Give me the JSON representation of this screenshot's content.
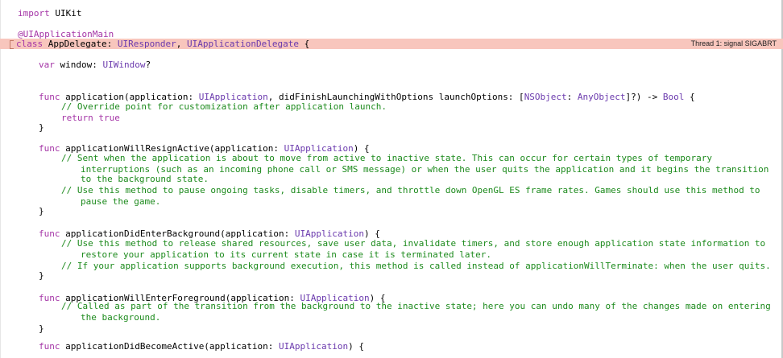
{
  "editor": {
    "lines": [
      [
        {
          "t": "import ",
          "c": "kw"
        },
        {
          "t": "UIKit",
          "c": "tx"
        }
      ],
      [],
      [
        {
          "t": "@UIApplicationMain",
          "c": "kw"
        }
      ],
      [
        {
          "t": "class ",
          "c": "kw"
        },
        {
          "t": "AppDelegate: ",
          "c": "tx"
        },
        {
          "t": "UIResponder",
          "c": "ty"
        },
        {
          "t": ", ",
          "c": "tx"
        },
        {
          "t": "UIApplicationDelegate",
          "c": "ty"
        },
        {
          "t": " {",
          "c": "tx"
        }
      ],
      [],
      [
        {
          "t": "var ",
          "c": "kw"
        },
        {
          "t": "window: ",
          "c": "tx"
        },
        {
          "t": "UIWindow",
          "c": "ty"
        },
        {
          "t": "?",
          "c": "tx"
        }
      ],
      [],
      [],
      [
        {
          "t": "func ",
          "c": "kw"
        },
        {
          "t": "application(application: ",
          "c": "tx"
        },
        {
          "t": "UIApplication",
          "c": "ty"
        },
        {
          "t": ", didFinishLaunchingWithOptions launchOptions: [",
          "c": "tx"
        },
        {
          "t": "NSObject",
          "c": "ty"
        },
        {
          "t": ": ",
          "c": "tx"
        },
        {
          "t": "AnyObject",
          "c": "ty"
        },
        {
          "t": "]?) -> ",
          "c": "tx"
        },
        {
          "t": "Bool",
          "c": "ty"
        },
        {
          "t": " {",
          "c": "tx"
        }
      ],
      [
        {
          "t": "// Override point for customization after application launch.",
          "c": "cm"
        }
      ],
      [
        {
          "t": "return ",
          "c": "kw"
        },
        {
          "t": "true",
          "c": "kw"
        }
      ],
      [
        {
          "t": "}",
          "c": "tx"
        }
      ],
      [],
      [
        {
          "t": "func ",
          "c": "kw"
        },
        {
          "t": "applicationWillResignActive(application: ",
          "c": "tx"
        },
        {
          "t": "UIApplication",
          "c": "ty"
        },
        {
          "t": ") {",
          "c": "tx"
        }
      ],
      [
        {
          "t": "// Sent when the application is about to move from active to inactive state. This can occur for certain types of temporary",
          "c": "cm"
        }
      ],
      [
        {
          "t": "interruptions (such as an incoming phone call or SMS message) or when the user quits the application and it begins the transition",
          "c": "cm"
        }
      ],
      [
        {
          "t": "to the background state.",
          "c": "cm"
        }
      ],
      [
        {
          "t": "// Use this method to pause ongoing tasks, disable timers, and throttle down OpenGL ES frame rates. Games should use this method to",
          "c": "cm"
        }
      ],
      [
        {
          "t": "pause the game.",
          "c": "cm"
        }
      ],
      [
        {
          "t": "}",
          "c": "tx"
        }
      ],
      [],
      [
        {
          "t": "func ",
          "c": "kw"
        },
        {
          "t": "applicationDidEnterBackground(application: ",
          "c": "tx"
        },
        {
          "t": "UIApplication",
          "c": "ty"
        },
        {
          "t": ") {",
          "c": "tx"
        }
      ],
      [
        {
          "t": "// Use this method to release shared resources, save user data, invalidate timers, and store enough application state information to",
          "c": "cm"
        }
      ],
      [
        {
          "t": "restore your application to its current state in case it is terminated later.",
          "c": "cm"
        }
      ],
      [
        {
          "t": "// If your application supports background execution, this method is called instead of applicationWillTerminate: when the user quits.",
          "c": "cm"
        }
      ],
      [
        {
          "t": "}",
          "c": "tx"
        }
      ],
      [],
      [
        {
          "t": "func ",
          "c": "kw"
        },
        {
          "t": "applicationWillEnterForeground(application: ",
          "c": "tx"
        },
        {
          "t": "UIApplication",
          "c": "ty"
        },
        {
          "t": ") {",
          "c": "tx"
        }
      ],
      [
        {
          "t": "// Called as part of the transition from the background to the inactive state; here you can undo many of the changes made on entering",
          "c": "cm"
        }
      ],
      [
        {
          "t": "the background.",
          "c": "cm"
        }
      ],
      [
        {
          "t": "}",
          "c": "tx"
        }
      ],
      [],
      [
        {
          "t": "func ",
          "c": "kw"
        },
        {
          "t": "applicationDidBecomeActive(application: ",
          "c": "tx"
        },
        {
          "t": "UIApplication",
          "c": "ty"
        },
        {
          "t": ") {",
          "c": "tx"
        }
      ]
    ],
    "error_line": 3,
    "error_message": "Thread 1: signal SIGABRT",
    "colors": {
      "keyword": "#a434a6",
      "type": "#6a39ad",
      "comment": "#1c8a1c",
      "error_highlight": "#f8c6bd"
    }
  }
}
